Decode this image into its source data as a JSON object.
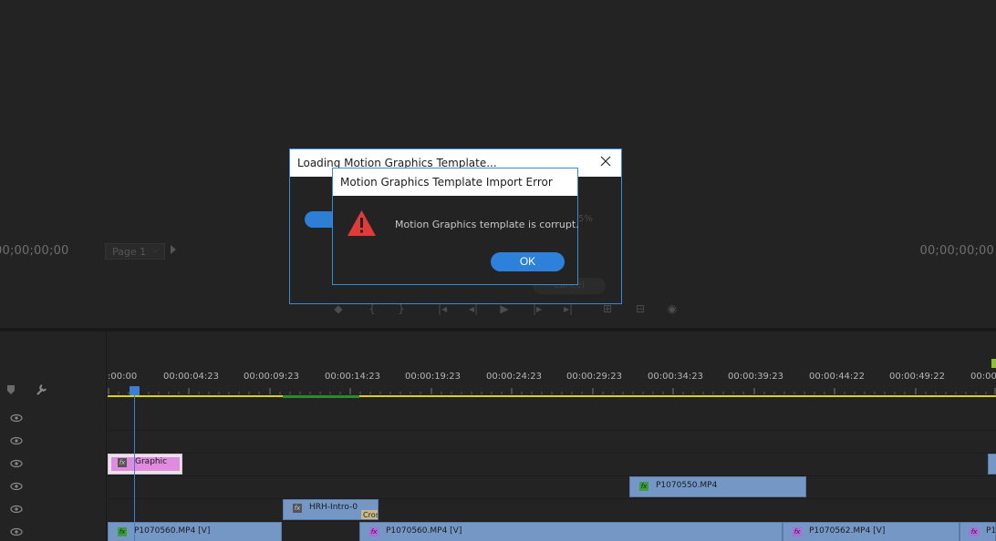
{
  "monitor": {
    "timecode_left": "00;00;00;00",
    "timecode_right": "00;00;00;00",
    "page_select": "Page 1"
  },
  "timeline": {
    "ruler_labels": [
      ":00:00",
      "00:00:04:23",
      "00:00:09:23",
      "00:00:14:23",
      "00:00:19:23",
      "00:00:24:23",
      "00:00:29:23",
      "00:00:34:23",
      "00:00:39:23",
      "00:00:44:22",
      "00:00:49:22",
      "00:00"
    ],
    "clips": {
      "graphic": "Graphic",
      "p1070550": "P1070550.MP4",
      "hrh_intro": "HRH-Intro-0",
      "cross": "Cros",
      "p1070560_a": "P1070560.MP4 [V]",
      "p1070560_b": "P1070560.MP4 [V]",
      "p1070562": "P1070562.MP4 [V]",
      "p1_tail": "P1"
    },
    "fx_label": "fx"
  },
  "loading_dialog": {
    "title": "Loading Motion Graphics Template...",
    "percent": "5%",
    "cancel_label": "Cancel"
  },
  "error_dialog": {
    "title": "Motion Graphics Template Import Error",
    "message": "Motion Graphics template is corrupt.",
    "ok_label": "OK"
  },
  "colors": {
    "accent": "#2d81db",
    "clip_blue": "#7497c6",
    "graphic_pink": "#e08ae0",
    "warning_red": "#e03b3b",
    "work_area_yellow": "#d6d21e"
  }
}
